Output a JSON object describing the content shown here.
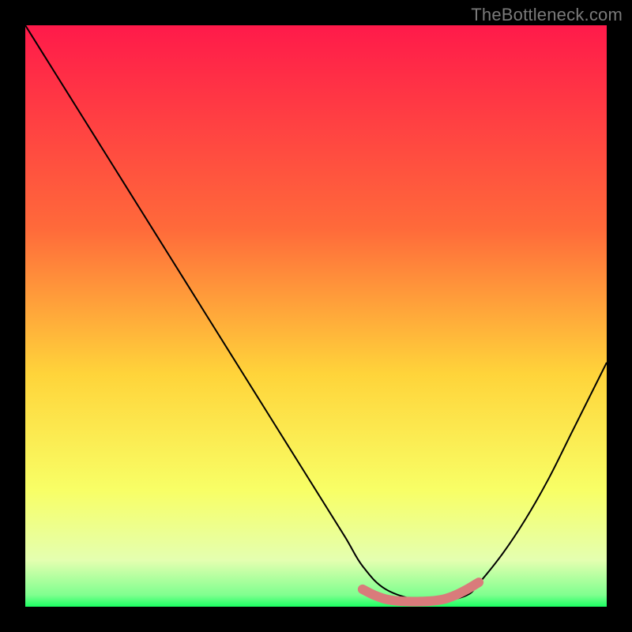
{
  "watermark": "TheBottleneck.com",
  "chart_data": {
    "type": "line",
    "title": "",
    "xlabel": "",
    "ylabel": "",
    "xlim": [
      0,
      100
    ],
    "ylim": [
      0,
      100
    ],
    "grid": false,
    "legend": false,
    "background_gradient": {
      "stops": [
        {
          "offset": 0.0,
          "color": "#ff1a4a"
        },
        {
          "offset": 0.35,
          "color": "#ff6a3a"
        },
        {
          "offset": 0.6,
          "color": "#ffd43a"
        },
        {
          "offset": 0.8,
          "color": "#f8ff66"
        },
        {
          "offset": 0.92,
          "color": "#e4ffb0"
        },
        {
          "offset": 0.98,
          "color": "#7fff8f"
        },
        {
          "offset": 1.0,
          "color": "#1bff62"
        }
      ]
    },
    "series": [
      {
        "name": "bottleneck-curve",
        "color": "#000000",
        "x": [
          0,
          5,
          10,
          15,
          20,
          25,
          30,
          35,
          40,
          45,
          50,
          55,
          58,
          62,
          68,
          72,
          76,
          78,
          82,
          86,
          90,
          94,
          98,
          100
        ],
        "y": [
          100,
          92,
          84,
          76,
          68,
          60,
          52,
          44,
          36,
          28,
          20,
          12,
          7,
          3,
          1,
          1,
          2,
          4,
          9,
          15,
          22,
          30,
          38,
          42
        ]
      },
      {
        "name": "optimal-marker",
        "color": "#d97b7b",
        "style": "thick-flat",
        "x": [
          58,
          60,
          62,
          64,
          66,
          68,
          70,
          72,
          74,
          76,
          78
        ],
        "y": [
          3.0,
          2.0,
          1.3,
          1.0,
          0.9,
          0.9,
          1.0,
          1.3,
          2.0,
          3.0,
          4.2
        ]
      }
    ]
  }
}
